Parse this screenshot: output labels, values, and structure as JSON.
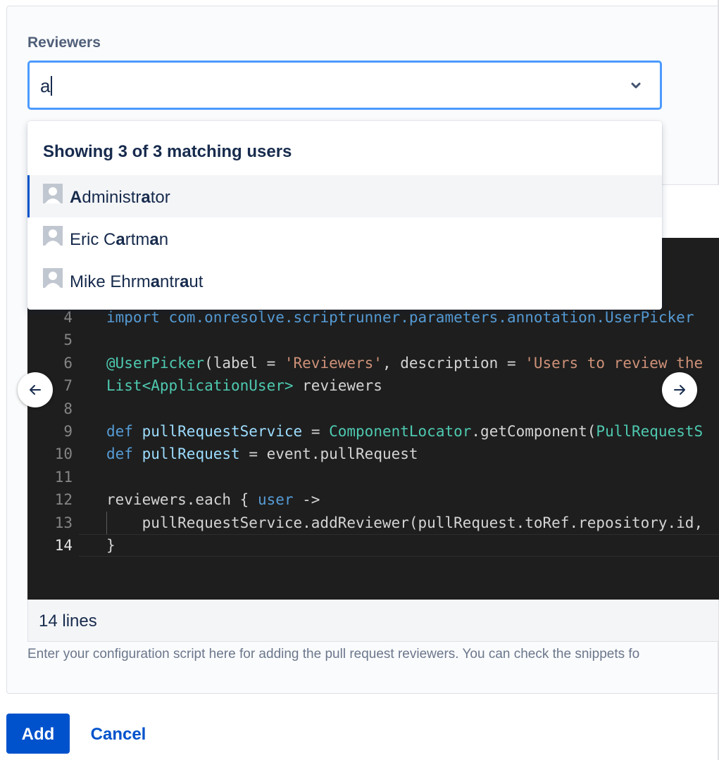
{
  "form": {
    "reviewers_label": "Reviewers",
    "reviewers_value": "a"
  },
  "dropdown": {
    "header": "Showing 3 of 3 matching users",
    "users": [
      {
        "parts": [
          {
            "t": "A",
            "b": true
          },
          {
            "t": "dministr",
            "b": false
          },
          {
            "t": "a",
            "b": true
          },
          {
            "t": "tor",
            "b": false
          }
        ],
        "name": "Administrator",
        "highlighted": true
      },
      {
        "parts": [
          {
            "t": "Eric C",
            "b": false
          },
          {
            "t": "a",
            "b": true
          },
          {
            "t": "rtm",
            "b": false
          },
          {
            "t": "a",
            "b": true
          },
          {
            "t": "n",
            "b": false
          }
        ],
        "name": "Eric Cartman",
        "highlighted": false
      },
      {
        "parts": [
          {
            "t": "Mike Ehrm",
            "b": false
          },
          {
            "t": "a",
            "b": true
          },
          {
            "t": "ntr",
            "b": false
          },
          {
            "t": "a",
            "b": true
          },
          {
            "t": "ut",
            "b": false
          }
        ],
        "name": "Mike Ehrmantraut",
        "highlighted": false
      }
    ]
  },
  "editor": {
    "lines": [
      {
        "n": "4",
        "text": "import com.onresolve.scriptrunner.parameters.annotation.UserPicker"
      },
      {
        "n": "5",
        "text": ""
      },
      {
        "n": "6",
        "text": "@UserPicker(label = 'Reviewers', description = 'Users to review the"
      },
      {
        "n": "7",
        "text": "List<ApplicationUser> reviewers"
      },
      {
        "n": "8",
        "text": ""
      },
      {
        "n": "9",
        "text": "def pullRequestService = ComponentLocator.getComponent(PullRequestS"
      },
      {
        "n": "10",
        "text": "def pullRequest = event.pullRequest"
      },
      {
        "n": "11",
        "text": ""
      },
      {
        "n": "12",
        "text": "reviewers.each { user ->"
      },
      {
        "n": "13",
        "text": "    pullRequestService.addReviewer(pullRequest.toRef.repository.id,"
      },
      {
        "n": "14",
        "text": "}"
      }
    ],
    "active_line": "14",
    "line_count_label": "14 lines"
  },
  "help_text": "Enter your configuration script here for adding the pull request reviewers. You can check the snippets fo",
  "buttons": {
    "add": "Add",
    "cancel": "Cancel"
  },
  "icons": {
    "chevron": "chevron-down-icon",
    "prev": "arrow-left-icon",
    "next": "arrow-right-icon",
    "avatar": "default-avatar-icon"
  },
  "colors": {
    "accent": "#0052cc",
    "focus_border": "#4c9aff",
    "editor_bg": "#1e1e1e"
  }
}
